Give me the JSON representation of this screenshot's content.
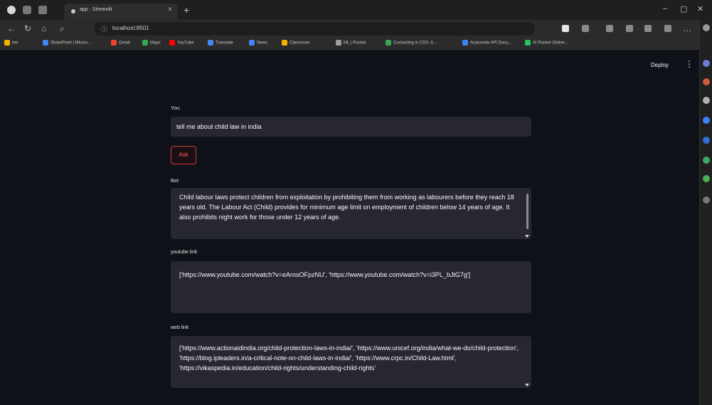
{
  "browser": {
    "tab_title": "app · Streamlit",
    "new_tab": "+",
    "tab_close": "×",
    "address": "localhost:8501",
    "window_controls": [
      "–",
      "▢",
      "✕"
    ],
    "bookmarks": [
      {
        "label": "Imt",
        "color": "#f4b400"
      },
      {
        "label": "SharePoint | Micros...",
        "color": "#4285f4"
      },
      {
        "label": "Gmail",
        "color": "#ea4335"
      },
      {
        "label": "Maps",
        "color": "#34a853"
      },
      {
        "label": "YouTube",
        "color": "#ff0000"
      },
      {
        "label": "Translate",
        "color": "#4285f4"
      },
      {
        "label": "News",
        "color": "#4285f4"
      },
      {
        "label": "Classroom",
        "color": "#f4b400"
      },
      {
        "label": "ML | Pocket",
        "color": "#9e9e9e"
      },
      {
        "label": "Contacting in CSS: A...",
        "color": "#34a853"
      },
      {
        "label": "Anaconda API Docu...",
        "color": "#3b82f6"
      },
      {
        "label": "AI Pocket Online...",
        "color": "#22c55e"
      }
    ]
  },
  "app": {
    "deploy_label": "Deploy",
    "menu_icon": "⋮",
    "you_label": "You:",
    "query": "tell me about child law in india",
    "ask_label": "Ask",
    "bot_label": "Bot:",
    "bot_answer": "Child labour laws protect children from exploitation by prohibiting them from working as labourers before they reach 18 years old. The Labour Act (Child) provides for minimum age limit on employment of children below 14 years of age. It also prohibits night work for those under 12 years of age.",
    "youtube_label": "youtube link",
    "youtube_links": "['https://www.youtube.com/watch?v=eArosOFpzNU', 'https://www.youtube.com/watch?v=i3PL_bJtG7g']",
    "web_label": "web link",
    "web_links": "['https://www.actionaidindia.org/child-protection-laws-in-india/', 'https://www.unicef.org/india/what-we-do/child-protection', 'https://blog.ipleaders.in/a-critical-note-on-child-laws-in-india/', 'https://www.crpc.in/Child-Law.html', 'https://vikaspedia.in/education/child-rights/understanding-child-rights'"
  }
}
